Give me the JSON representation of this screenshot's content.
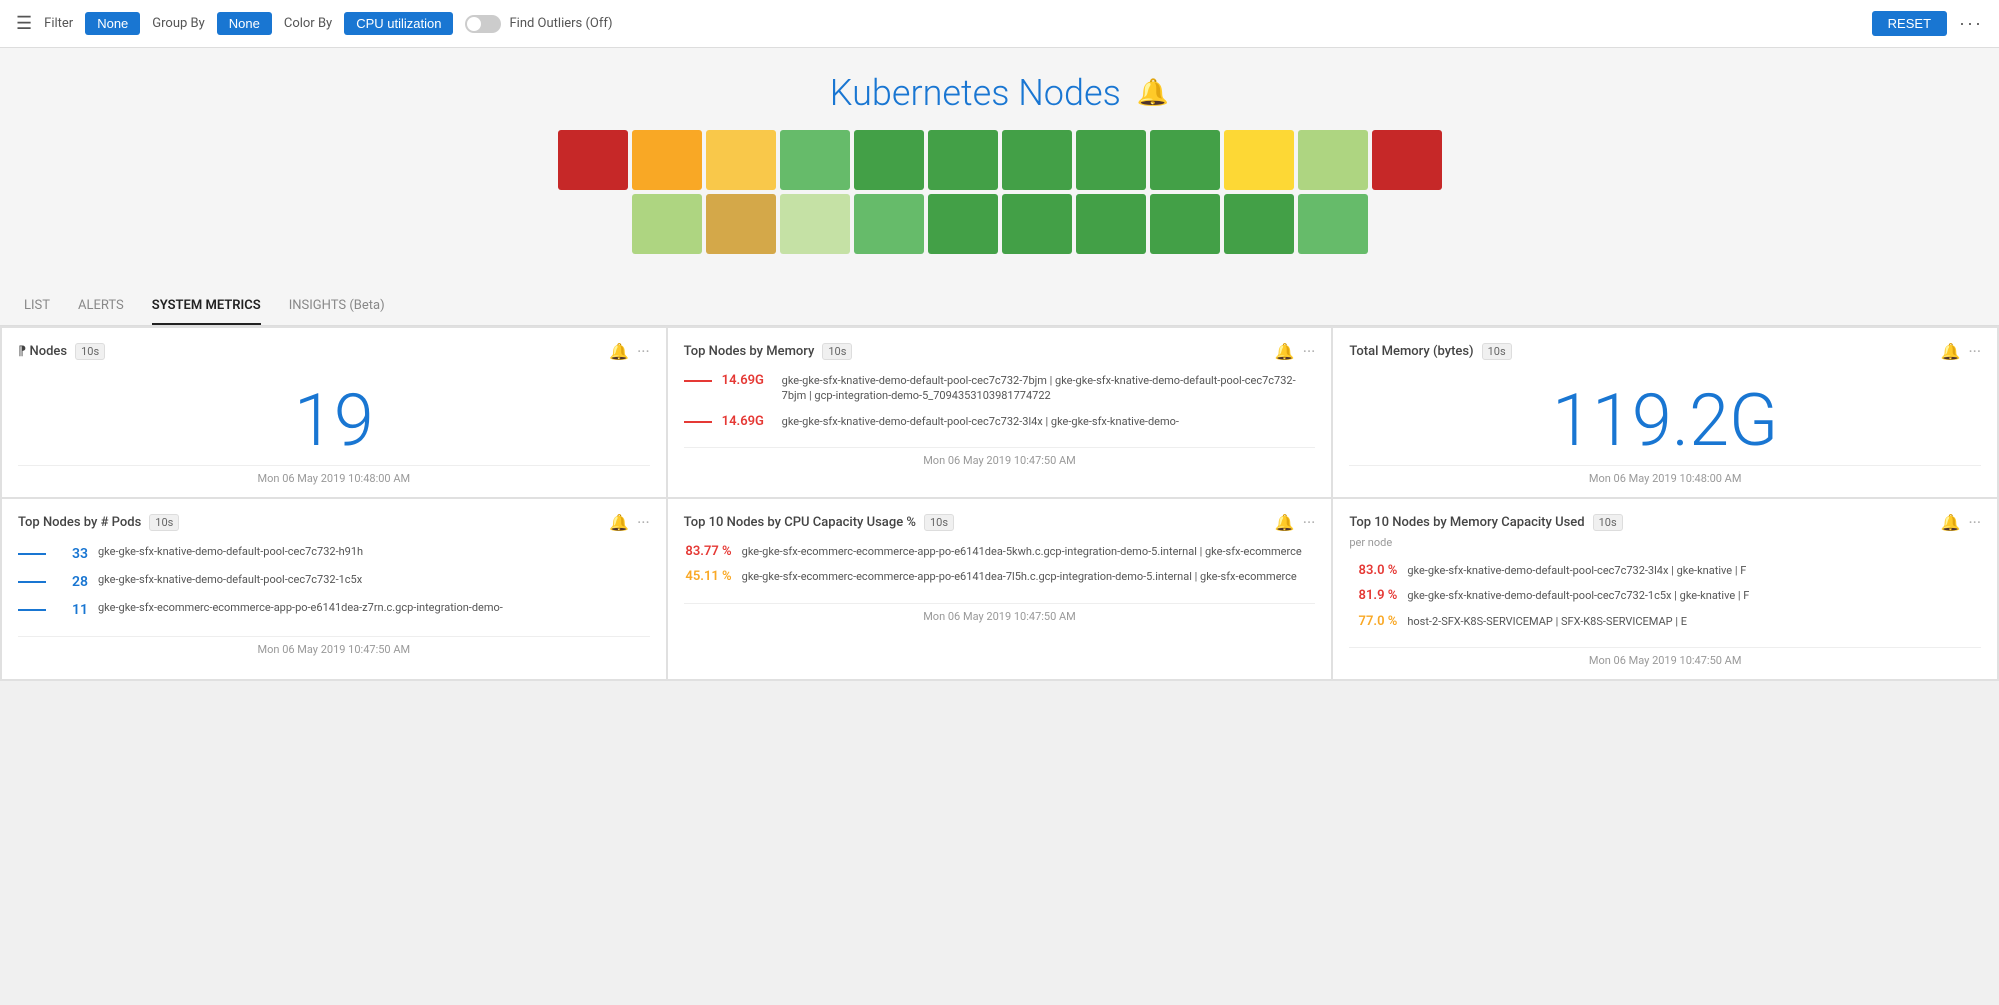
{
  "topbar": {
    "filter_label": "Filter",
    "filter_value": "None",
    "group_by_label": "Group By",
    "group_by_value": "None",
    "color_by_label": "Color By",
    "color_by_value": "CPU utilization",
    "find_outliers_label": "Find Outliers (Off)",
    "reset_label": "RESET",
    "more_icon": "···"
  },
  "hero": {
    "title": "Kubernetes Nodes",
    "bell_icon": "🔔"
  },
  "tiles": {
    "row1": [
      {
        "color": "#c62828"
      },
      {
        "color": "#f9a825"
      },
      {
        "color": "#f9c84a"
      },
      {
        "color": "#66bb6a"
      },
      {
        "color": "#43a047"
      },
      {
        "color": "#43a047"
      },
      {
        "color": "#43a047"
      },
      {
        "color": "#43a047"
      },
      {
        "color": "#43a047"
      },
      {
        "color": "#fdd835"
      },
      {
        "color": "#aed581"
      },
      {
        "color": "#c62828"
      }
    ],
    "row2": [
      {
        "color": "#aed581"
      },
      {
        "color": "#d4a849"
      },
      {
        "color": "#c5e1a5"
      },
      {
        "color": "#66bb6a"
      },
      {
        "color": "#43a047"
      },
      {
        "color": "#43a047"
      },
      {
        "color": "#43a047"
      },
      {
        "color": "#43a047"
      },
      {
        "color": "#43a047"
      },
      {
        "color": "#66bb6a"
      }
    ]
  },
  "tabs": [
    {
      "label": "LIST",
      "active": false
    },
    {
      "label": "ALERTS",
      "active": false
    },
    {
      "label": "SYSTEM METRICS",
      "active": true
    },
    {
      "label": "INSIGHTS (Beta)",
      "active": false
    }
  ],
  "cards": [
    {
      "id": "nodes-count",
      "title": "# Nodes",
      "badge": "10s",
      "big_number": "19",
      "timestamp": "Mon 06 May 2019 10:48:00 AM"
    },
    {
      "id": "top-nodes-memory",
      "title": "Top Nodes by Memory",
      "badge": "10s",
      "timestamp": "Mon 06 May 2019 10:47:50 AM",
      "items": [
        {
          "line_color": "red",
          "value": "14.69G",
          "label": "gke-gke-sfx-knative-demo-default-pool-cec7c732-7bjm | gke-gke-sfx-knative-demo-default-pool-cec7c732-7bjm | gcp-integration-demo-5_7094353103981774722"
        },
        {
          "line_color": "red",
          "value": "14.69G",
          "label": "gke-gke-sfx-knative-demo-default-pool-cec7c732-3l4x | gke-gke-sfx-knative-demo-"
        }
      ]
    },
    {
      "id": "total-memory",
      "title": "Total Memory (bytes)",
      "badge": "10s",
      "big_number": "119.2G",
      "timestamp": "Mon 06 May 2019 10:48:00 AM"
    },
    {
      "id": "top-nodes-pods",
      "title": "Top Nodes by # Pods",
      "badge": "10s",
      "timestamp": "Mon 06 May 2019 10:47:50 AM",
      "items": [
        {
          "line_color": "blue",
          "value": "33",
          "label": "gke-gke-sfx-knative-demo-default-pool-cec7c732-h91h"
        },
        {
          "line_color": "blue",
          "value": "28",
          "label": "gke-gke-sfx-knative-demo-default-pool-cec7c732-1c5x"
        },
        {
          "line_color": "blue",
          "value": "11",
          "label": "gke-gke-sfx-ecommerc-ecommerce-app-po-e6141dea-z7rn.c.gcp-integration-demo-"
        }
      ]
    },
    {
      "id": "top-10-cpu",
      "title": "Top 10 Nodes by CPU Capacity Usage %",
      "badge": "10s",
      "timestamp": "Mon 06 May 2019 10:47:50 AM",
      "items": [
        {
          "value": "83.77 %",
          "value_color": "red",
          "label": "gke-gke-sfx-ecommerc-ecommerce-app-po-e6141dea-5kwh.c.gcp-integration-demo-5.internal | gke-sfx-ecommerce"
        },
        {
          "value": "45.11 %",
          "value_color": "yellow",
          "label": "gke-gke-sfx-ecommerc-ecommerce-app-po-e6141dea-7l5h.c.gcp-integration-demo-5.internal | gke-sfx-ecommerce"
        }
      ]
    },
    {
      "id": "top-10-memory-capacity",
      "title": "Top 10 Nodes by Memory Capacity Used",
      "badge": "10s",
      "per_node": "per node",
      "timestamp": "Mon 06 May 2019 10:47:50 AM",
      "items": [
        {
          "value": "83.0 %",
          "value_color": "red",
          "label": "gke-gke-sfx-knative-demo-default-pool-cec7c732-3l4x | gke-knative | F"
        },
        {
          "value": "81.9 %",
          "value_color": "red",
          "label": "gke-gke-sfx-knative-demo-default-pool-cec7c732-1c5x | gke-knative | F"
        },
        {
          "value": "77.0 %",
          "value_color": "yellow",
          "label": "host-2-SFX-K8S-SERVICEMAP | SFX-K8S-SERVICEMAP | E"
        }
      ]
    }
  ]
}
